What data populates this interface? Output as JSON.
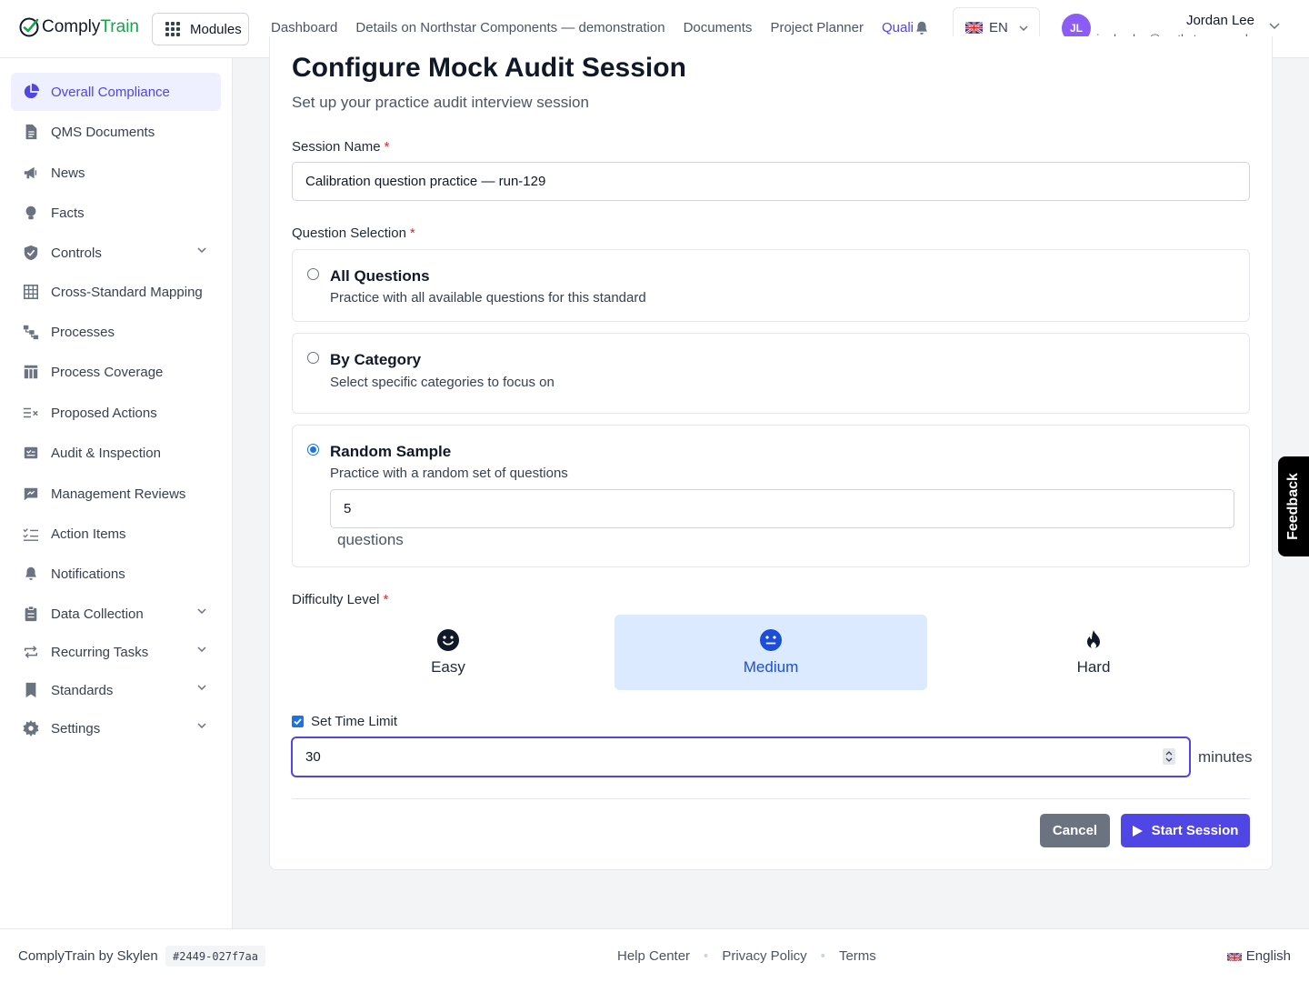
{
  "brand": {
    "name_part1": "Comply",
    "name_part2": "Train"
  },
  "header": {
    "modules_label": "Modules",
    "nav": [
      "Dashboard",
      "Details on Northstar Components — demonstration",
      "Documents",
      "Project Planner",
      "Quali"
    ],
    "language": "EN",
    "user": {
      "initials": "JL",
      "name": "Jordan Lee",
      "email": "jordan.lee@northstar.example"
    }
  },
  "sidebar": {
    "items": [
      {
        "label": "Overall Compliance",
        "icon": "pie-chart-icon"
      },
      {
        "label": "QMS Documents",
        "icon": "document-icon"
      },
      {
        "label": "News",
        "icon": "megaphone-icon"
      },
      {
        "label": "Facts",
        "icon": "lightbulb-icon"
      },
      {
        "label": "Controls",
        "icon": "shield-check-icon"
      },
      {
        "label": "Cross-Standard Mapping",
        "icon": "table-grid-icon"
      },
      {
        "label": "Processes",
        "icon": "process-flow-icon"
      },
      {
        "label": "Process Coverage",
        "icon": "table-columns-icon"
      },
      {
        "label": "Proposed Actions",
        "icon": "list-x-icon"
      },
      {
        "label": "Audit & Inspection",
        "icon": "clipboard-check-icon"
      },
      {
        "label": "Management Reviews",
        "icon": "review-icon"
      },
      {
        "label": "Action Items",
        "icon": "list-check-icon"
      },
      {
        "label": "Notifications",
        "icon": "bell-icon"
      },
      {
        "label": "Data Collection",
        "icon": "clipboard-icon"
      },
      {
        "label": "Recurring Tasks",
        "icon": "repeat-icon"
      },
      {
        "label": "Standards",
        "icon": "bookmark-icon"
      },
      {
        "label": "Settings",
        "icon": "gear-icon"
      }
    ]
  },
  "form": {
    "title": "Configure Mock Audit Session",
    "subtitle": "Set up your practice audit interview session",
    "session_name_label": "Session Name",
    "session_name_value": "Calibration question practice — run-129",
    "question_selection_label": "Question Selection",
    "options": [
      {
        "title": "All Questions",
        "desc": "Practice with all available questions for this standard"
      },
      {
        "title": "By Category",
        "desc": "Select specific categories to focus on"
      },
      {
        "title": "Random Sample",
        "desc": "Practice with a random set of questions"
      }
    ],
    "selected_option": "Random Sample",
    "question_count": "5",
    "questions_suffix": "questions",
    "difficulty_label": "Difficulty Level",
    "difficulties": [
      "Easy",
      "Medium",
      "Hard"
    ],
    "selected_difficulty": "Medium",
    "time_limit_label": "Set Time Limit",
    "time_limit_checked": true,
    "time_limit_value": "30",
    "minutes_suffix": "minutes",
    "cancel_label": "Cancel",
    "start_label": "Start Session",
    "required_mark": "*"
  },
  "feedback_label": "Feedback",
  "footer": {
    "brand": "ComplyTrain by Skylen",
    "build_hash": "#2449-027f7aa",
    "links": [
      "Help Center",
      "Privacy Policy",
      "Terms"
    ],
    "separator": "•",
    "language": "English"
  },
  "colors": {
    "accent": "#4f46e5",
    "brand_green": "#16a34a",
    "selected_bg": "#dbeafe",
    "radio_blue": "#1a73e8"
  }
}
